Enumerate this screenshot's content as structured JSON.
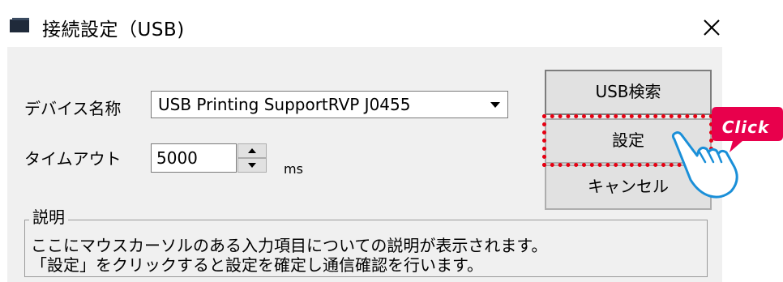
{
  "window": {
    "title": "接続設定（USB)",
    "close_glyph": "✕"
  },
  "form": {
    "device_label": "デバイス名称",
    "device_value": "USB Printing SupportRVP J0455",
    "timeout_label": "タイムアウト",
    "timeout_value": "5000",
    "timeout_unit": "ms"
  },
  "buttons": {
    "usb_search": "USB検索",
    "settings": "設定",
    "cancel": "キャンセル"
  },
  "callout": {
    "text": "Click",
    "badge_color": "#e8004c",
    "highlight_color": "#e60012"
  },
  "description": {
    "title": "説明",
    "line1": "ここにマウスカーソルのある入力項目についての説明が表示されます。",
    "line2": "「設定」をクリックすると設定を確定し通信確認を行います。"
  },
  "icons": [
    "app-icon",
    "close-icon",
    "dropdown-arrow-icon",
    "spin-up-icon",
    "spin-down-icon",
    "pointing-hand-icon"
  ]
}
